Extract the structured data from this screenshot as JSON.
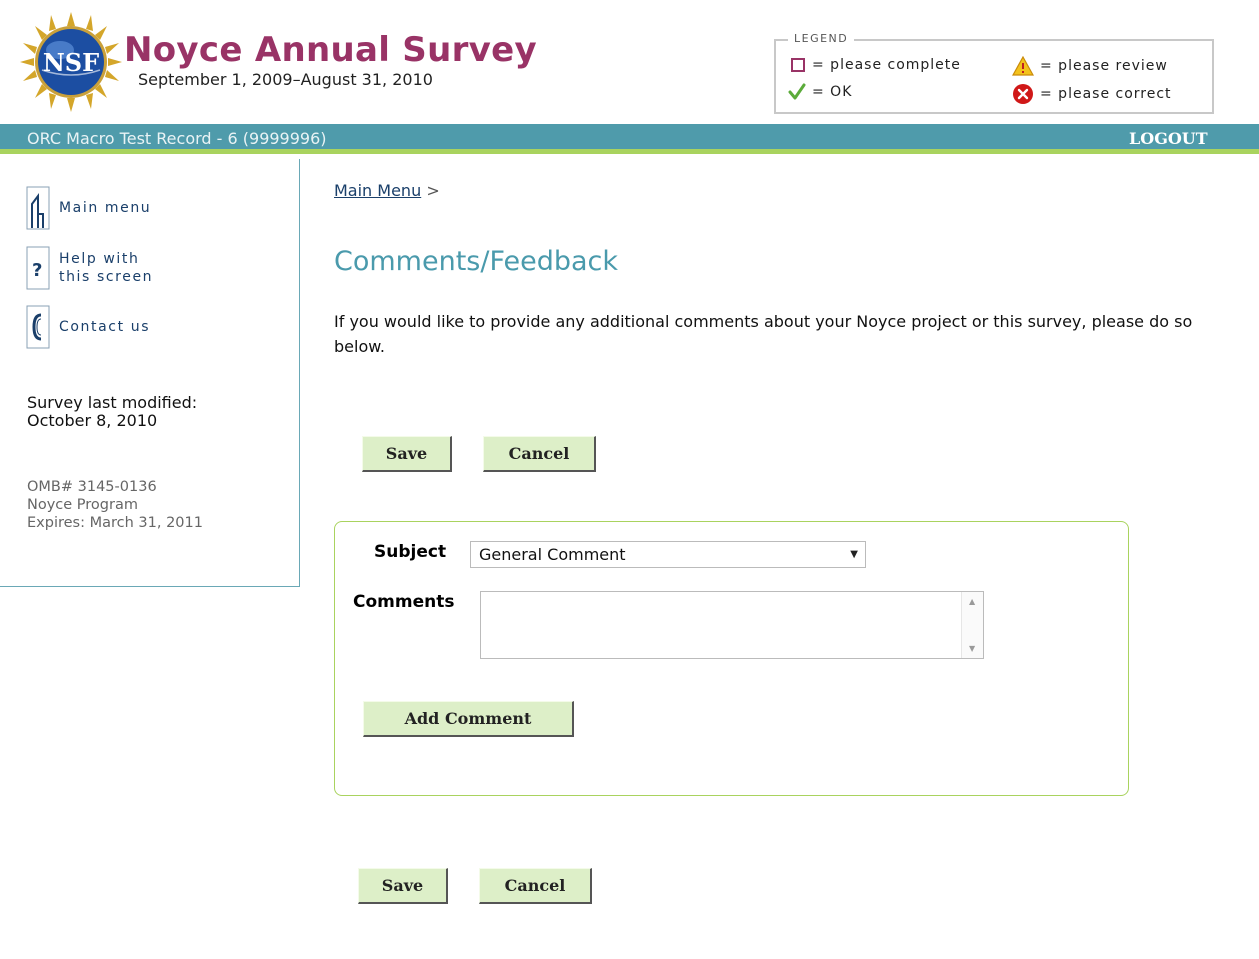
{
  "header": {
    "logo_text": "NSF",
    "title": "Noyce Annual Survey",
    "date_range": "September 1, 2009–August 31, 2010"
  },
  "legend": {
    "title": "LEGEND",
    "items": [
      {
        "icon": "incomplete-checkbox-icon",
        "label": "= please complete"
      },
      {
        "icon": "warning-icon",
        "label": "= please review"
      },
      {
        "icon": "checkmark-icon",
        "label": "= OK"
      },
      {
        "icon": "error-icon",
        "label": "= please correct"
      }
    ]
  },
  "topbar": {
    "record": "ORC Macro Test Record - 6 (9999996)",
    "logout": "LOGOUT"
  },
  "sidebar": {
    "links": [
      {
        "icon": "home-icon",
        "label_lines": [
          "Main menu"
        ]
      },
      {
        "icon": "help-icon",
        "label_lines": [
          "Help with",
          "this screen"
        ]
      },
      {
        "icon": "phone-icon",
        "label_lines": [
          "Contact us"
        ]
      }
    ],
    "modified_label": "Survey last modified:",
    "modified_date": "October 8, 2010",
    "omb": "OMB# 3145-0136",
    "program": "Noyce Program",
    "expires": "Expires: March 31, 2011"
  },
  "breadcrumb": {
    "link": "Main Menu",
    "separator": ">"
  },
  "page_title": "Comments/Feedback",
  "intro": "If you would like to provide any additional comments about your Noyce project or this survey, please do so below.",
  "buttons": {
    "save": "Save",
    "cancel": "Cancel",
    "add_comment": "Add Comment"
  },
  "form": {
    "subject_label": "Subject",
    "subject_value": "General Comment",
    "comments_label": "Comments",
    "comments_value": ""
  },
  "colors": {
    "title": "#993366",
    "topbar": "#4f9bab",
    "accent_green": "#a9d35e",
    "heading": "#4a9aac",
    "button_bg": "#ddefc8"
  }
}
